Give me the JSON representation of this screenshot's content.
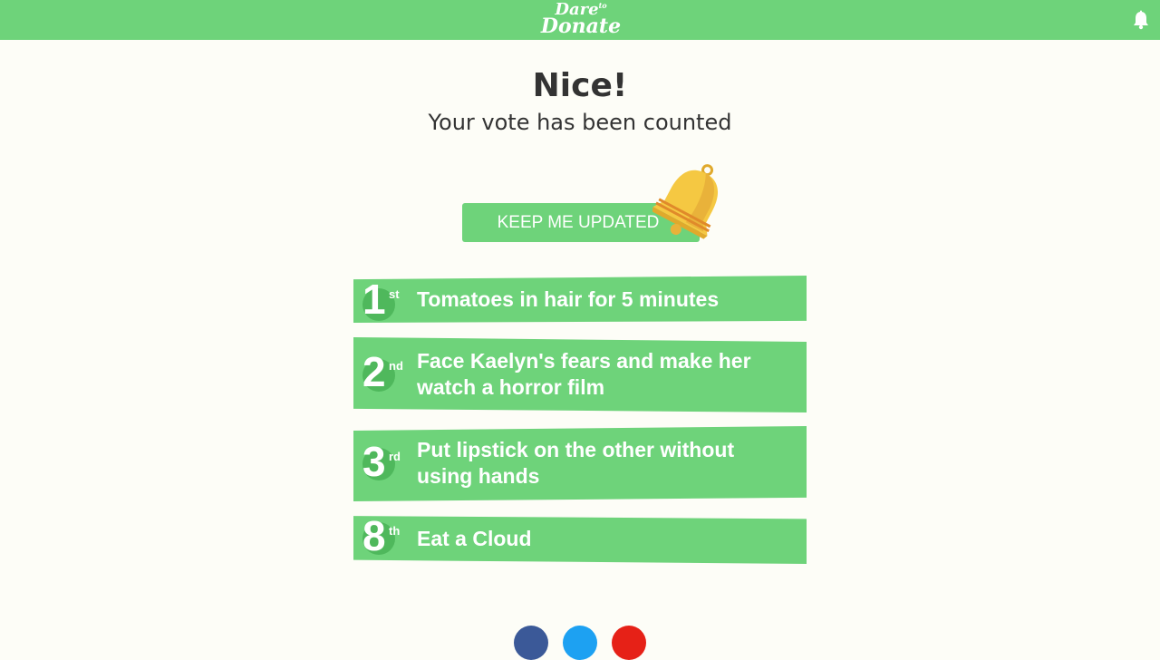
{
  "header": {
    "logo_line1": "Dare",
    "logo_small": "to",
    "logo_line2": "Donate",
    "bell_icon": "bell-icon"
  },
  "main": {
    "title": "Nice!",
    "subtitle": "Your vote has been counted",
    "keep_button_label": "KEEP ME UPDATED",
    "keep_button_icon": "golden-bell-icon"
  },
  "rankings": [
    {
      "number": "1",
      "suffix": "st",
      "dare": "Tomatoes in hair for 5 minutes"
    },
    {
      "number": "2",
      "suffix": "nd",
      "dare": "Face Kaelyn's fears and make her watch a horror film"
    },
    {
      "number": "3",
      "suffix": "rd",
      "dare": "Put lipstick on the other without using hands"
    },
    {
      "number": "8",
      "suffix": "th",
      "dare": "Eat a Cloud"
    }
  ],
  "social": [
    {
      "icon": "facebook-icon",
      "color": "#3b5998"
    },
    {
      "icon": "twitter-icon",
      "color": "#1da1f2"
    },
    {
      "icon": "youtube-icon",
      "color": "#e62117"
    }
  ],
  "colors": {
    "brand_green": "#6ed37a",
    "dark_green": "#4fb85c",
    "background": "#fdfdf7",
    "bell_gold": "#f5c842"
  }
}
